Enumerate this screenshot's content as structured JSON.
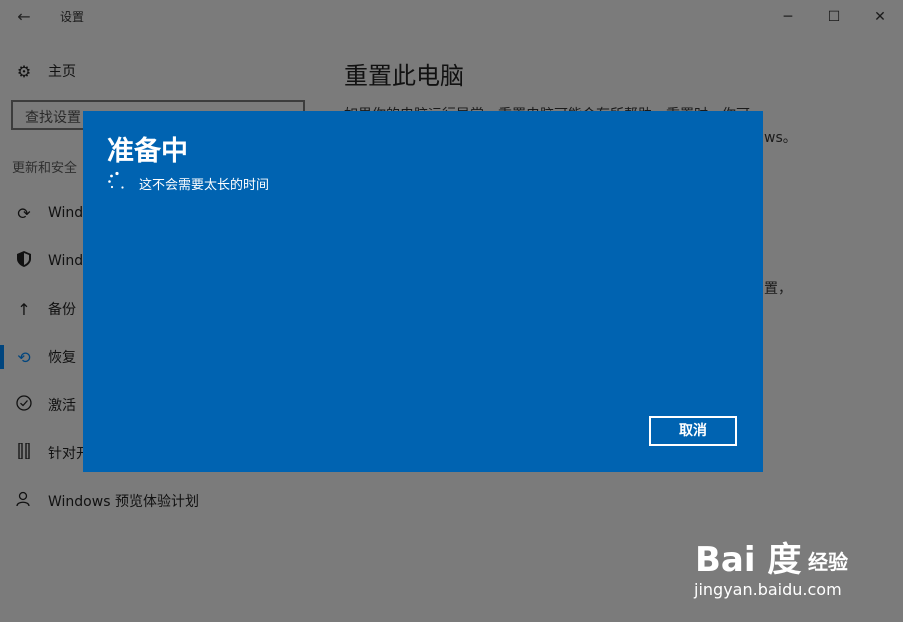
{
  "window": {
    "title": "设置",
    "back_glyph": "←",
    "minimize": "─",
    "maximize": "☐",
    "close": "✕"
  },
  "sidebar": {
    "home": {
      "label": "主页",
      "icon": "gear-icon"
    },
    "search": {
      "placeholder": "查找设置"
    },
    "section": "更新和安全",
    "items": [
      {
        "label": "Windo",
        "icon": "sync-icon"
      },
      {
        "label": "Windo",
        "icon": "shield-icon"
      },
      {
        "label": "备份",
        "icon": "up-arrow-icon"
      },
      {
        "label": "恢复",
        "icon": "history-icon",
        "active": true
      },
      {
        "label": "激活",
        "icon": "check-circle-icon"
      },
      {
        "label": "针对开",
        "icon": "tools-icon"
      },
      {
        "label": "Windows 预览体验计划",
        "icon": "person-icon"
      }
    ]
  },
  "main": {
    "title": "重置此电脑",
    "desc_line1": "如果你的电脑运行异常，重置电脑可能会有所帮助。重置时，你可",
    "desc_line2": "ws。",
    "desc_line3": "置，"
  },
  "dialog": {
    "title": "准备中",
    "message": "这不会需要太长的时间",
    "cancel_label": "取消",
    "color": "#0063b1"
  },
  "watermark": {
    "brand": "Bai 度",
    "product": "经验",
    "url": "jingyan.baidu.com"
  }
}
